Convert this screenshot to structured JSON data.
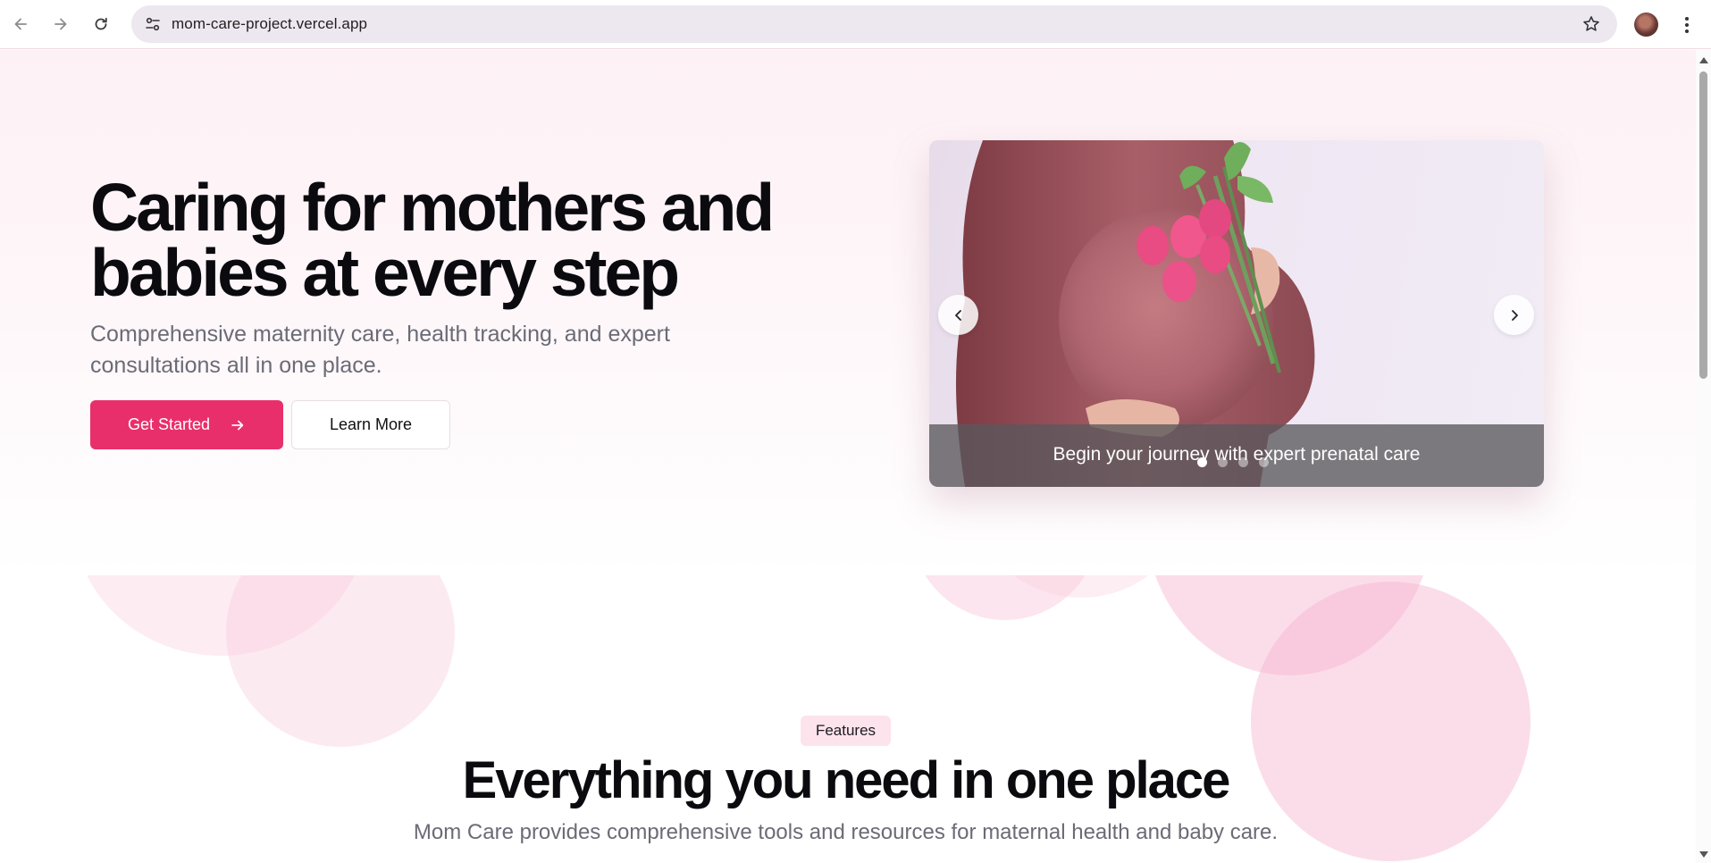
{
  "browser": {
    "url": "mom-care-project.vercel.app",
    "icons": {
      "back": "arrow-left",
      "forward": "arrow-right",
      "reload": "reload",
      "site_info": "tune",
      "bookmark": "star-outline",
      "menu": "three-dots-vertical"
    }
  },
  "hero": {
    "title": "Caring for mothers and\nbabies at every step",
    "subtitle": "Comprehensive maternity care, health tracking, and expert consultations all in one place.",
    "primary_button": "Get Started",
    "secondary_button": "Learn More"
  },
  "carousel": {
    "caption": "Begin your journey with expert prenatal care",
    "slide_count": 4,
    "active_slide": 1
  },
  "features": {
    "badge": "Features",
    "title": "Everything you need in one place",
    "subtitle": "Mom Care provides comprehensive tools and resources for maternal health and baby care."
  },
  "colors": {
    "accent": "#e92f6b",
    "badge_bg": "#fde3ec",
    "bubble": "#f7c6d9",
    "text_dark": "#0b0b0f",
    "text_muted": "#6b6b76"
  }
}
